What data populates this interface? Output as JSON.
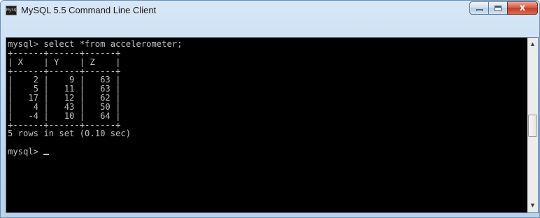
{
  "window": {
    "title": "MySQL 5.5 Command Line Client",
    "icon": "mysql-console-icon",
    "icon_glyph": "MySQL",
    "controls": {
      "minimize": "minimize-icon",
      "maximize": "maximize-icon",
      "close": "close-icon",
      "close_glyph": "x"
    },
    "accent_color": "#c23b23",
    "titlebar_color": "#c3daf1"
  },
  "console": {
    "background": "#000000",
    "foreground": "#c0c0c0",
    "lines": [
      "mysql> select *from accelerometer;",
      "+------+------+------+",
      "| X    | Y    | Z    |",
      "+------+------+------+",
      "|    2 |    9 |   63 |",
      "|    5 |   11 |   63 |",
      "|   17 |   12 |   62 |",
      "|    4 |   43 |   50 |",
      "|   -4 |   10 |   64 |",
      "+------+------+------+",
      "5 rows in set (0.10 sec)",
      "",
      "mysql> "
    ],
    "query": {
      "prompt": "mysql>",
      "statement": "select *from accelerometer;",
      "columns": [
        "X",
        "Y",
        "Z"
      ],
      "rows": [
        [
          2,
          9,
          63
        ],
        [
          5,
          11,
          63
        ],
        [
          17,
          12,
          62
        ],
        [
          4,
          43,
          50
        ],
        [
          -4,
          10,
          64
        ]
      ],
      "result_summary": "5 rows in set (0.10 sec)"
    }
  },
  "scrollbar": {
    "up_arrow": "scroll-up-arrow-icon",
    "up_glyph": "▲",
    "down_arrow": "scroll-down-arrow-icon",
    "down_glyph": "▼"
  }
}
